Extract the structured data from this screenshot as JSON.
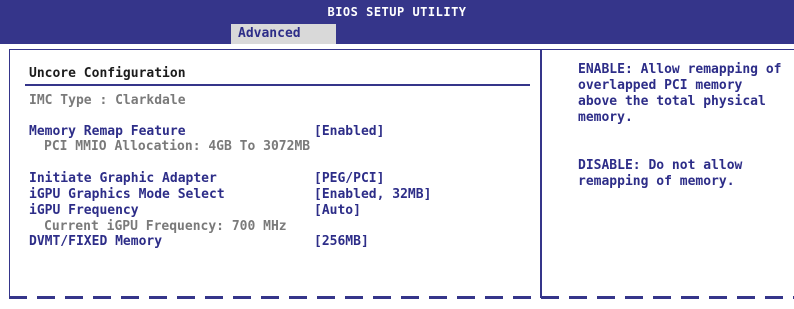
{
  "window": {
    "title": "BIOS SETUP UTILITY",
    "active_tab": "Advanced"
  },
  "section": {
    "title": "Uncore Configuration"
  },
  "items": [
    {
      "label": "IMC Type : Clarkdale",
      "value": ""
    },
    {
      "label": "Memory Remap Feature",
      "value": "[Enabled]"
    },
    {
      "label": "PCI MMIO Allocation: 4GB To 3072MB",
      "value": ""
    },
    {
      "label": "Initiate Graphic Adapter",
      "value": "[PEG/PCI]"
    },
    {
      "label": "iGPU Graphics Mode Select",
      "value": "[Enabled, 32MB]"
    },
    {
      "label": "iGPU Frequency",
      "value": "[Auto]"
    },
    {
      "label": "Current iGPU Frequency: 700 MHz",
      "value": ""
    },
    {
      "label": "DVMT/FIXED Memory",
      "value": "[256MB]"
    }
  ],
  "help": {
    "enable_text": "ENABLE: Allow remapping of overlapped PCI memory above the total physical memory.",
    "disable_text": "DISABLE: Do not allow remapping of memory."
  },
  "colors": {
    "accent": "#35358a",
    "item_text": "#2d2d88",
    "info_text": "#7a7a7a",
    "tab_background": "#d9d9d9",
    "background": "#ffffff"
  }
}
